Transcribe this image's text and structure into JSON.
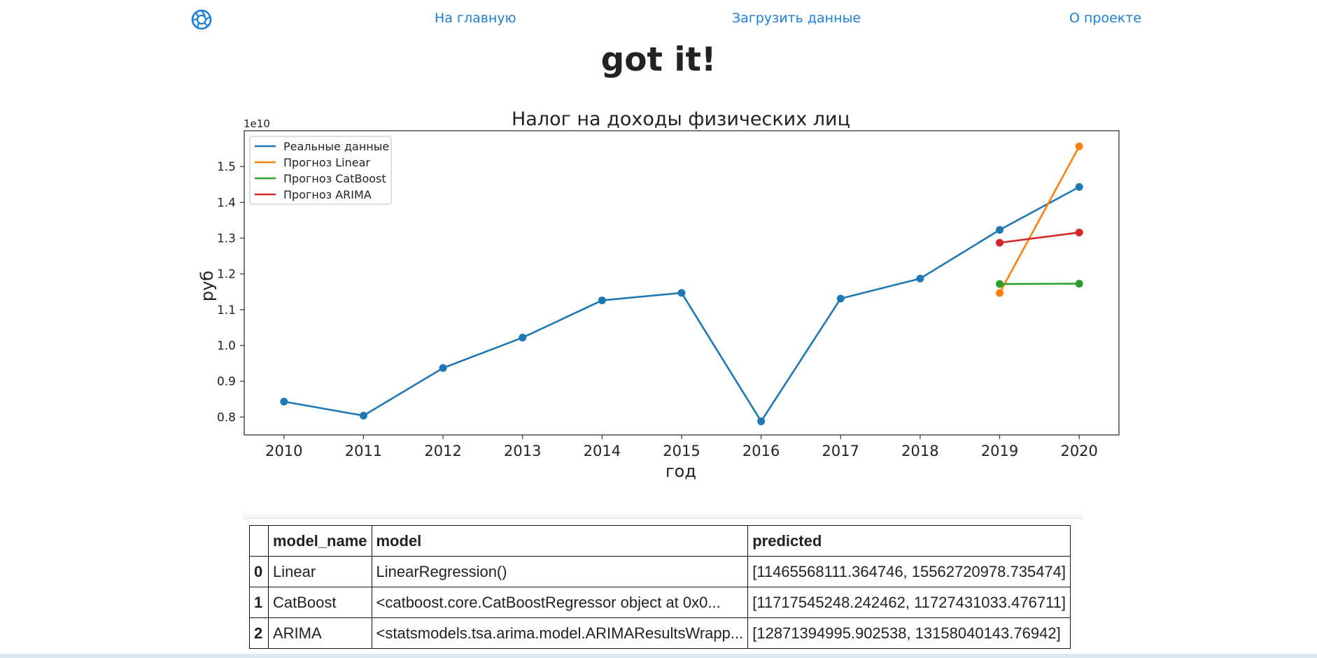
{
  "nav": {
    "logo_icon": "aperture-icon",
    "home": "На главную",
    "upload": "Загрузить данные",
    "about": "О проекте",
    "link_color": "#1a7fd8"
  },
  "page_title": "got it!",
  "chart_data": {
    "type": "line",
    "title": "Налог на доходы физических лиц",
    "xlabel": "год",
    "ylabel": "руб",
    "y_multiplier": "1e10",
    "x": [
      2010,
      2011,
      2012,
      2013,
      2014,
      2015,
      2016,
      2017,
      2018,
      2019,
      2020
    ],
    "ylim": [
      0.75,
      1.6
    ],
    "xlim": [
      2009.5,
      2020.5
    ],
    "y_ticks": [
      "0.8",
      "0.9",
      "1.0",
      "1.1",
      "1.2",
      "1.3",
      "1.4",
      "1.5"
    ],
    "legend_position": "top-left",
    "grid": false,
    "series": [
      {
        "name": "Реальные данные",
        "color": "#1f77b4",
        "x": [
          2010,
          2011,
          2012,
          2013,
          2014,
          2015,
          2016,
          2017,
          2018,
          2019,
          2020
        ],
        "y": [
          0.843,
          0.804,
          0.937,
          1.022,
          1.126,
          1.147,
          0.788,
          1.131,
          1.187,
          1.323,
          1.443
        ]
      },
      {
        "name": "Прогноз Linear",
        "color": "#ff7f0e",
        "x": [
          2019,
          2020
        ],
        "y": [
          1.1466,
          1.5563
        ]
      },
      {
        "name": "Прогноз CatBoost",
        "color": "#2ca02c",
        "x": [
          2019,
          2020
        ],
        "y": [
          1.1718,
          1.1727
        ]
      },
      {
        "name": "Прогноз ARIMA",
        "color": "#d62728",
        "x": [
          2019,
          2020
        ],
        "y": [
          1.2871,
          1.3158
        ]
      }
    ]
  },
  "results_table": {
    "headers": [
      "",
      "model_name",
      "model",
      "predicted"
    ],
    "rows": [
      [
        "0",
        "Linear",
        "LinearRegression()",
        "[11465568111.364746, 15562720978.735474]"
      ],
      [
        "1",
        "CatBoost",
        "<catboost.core.CatBoostRegressor object at 0x0...",
        "[11717545248.242462, 11727431033.476711]"
      ],
      [
        "2",
        "ARIMA",
        "<statsmodels.tsa.arima.model.ARIMAResultsWrapp...",
        "[12871394995.902538, 13158040143.76942]"
      ]
    ]
  }
}
